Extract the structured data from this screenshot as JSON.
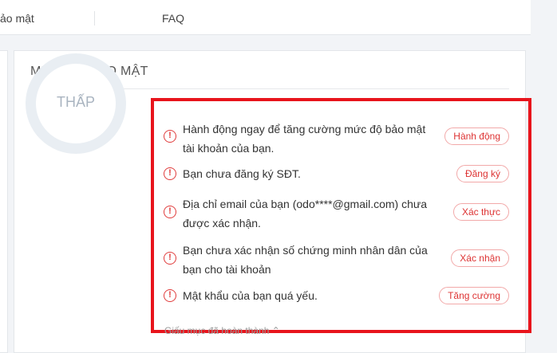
{
  "topbar": {
    "tab_security": "ảo mật",
    "tab_faq": "FAQ"
  },
  "card": {
    "title": "MỨC ĐỘ BẢO MẬT",
    "level_label": "THẤP"
  },
  "items": [
    {
      "text": "Hành động ngay để tăng cường mức độ bảo mật tài khoản của bạn.",
      "action": "Hành động"
    },
    {
      "text": "Bạn chưa đăng ký SĐT.",
      "action": "Đăng ký"
    },
    {
      "text": "Địa chỉ email của bạn (odo****@gmail.com) chưa được xác nhận.",
      "action": "Xác thực"
    },
    {
      "text": "Bạn chưa xác nhận số chứng minh nhân dân của bạn cho tài khoản",
      "action": "Xác nhận"
    },
    {
      "text": "Mật khẩu của bạn quá yếu.",
      "action": "Tăng cường"
    }
  ],
  "collapse_label": "Giấu mục đã hoàn thành",
  "colors": {
    "alert": "#e03c3c",
    "highlight_border": "#e8141c",
    "ring": "#e9eef3"
  },
  "icons": {
    "alert": "exclamation-circle-icon",
    "collapse": "chevron-up-icon"
  }
}
